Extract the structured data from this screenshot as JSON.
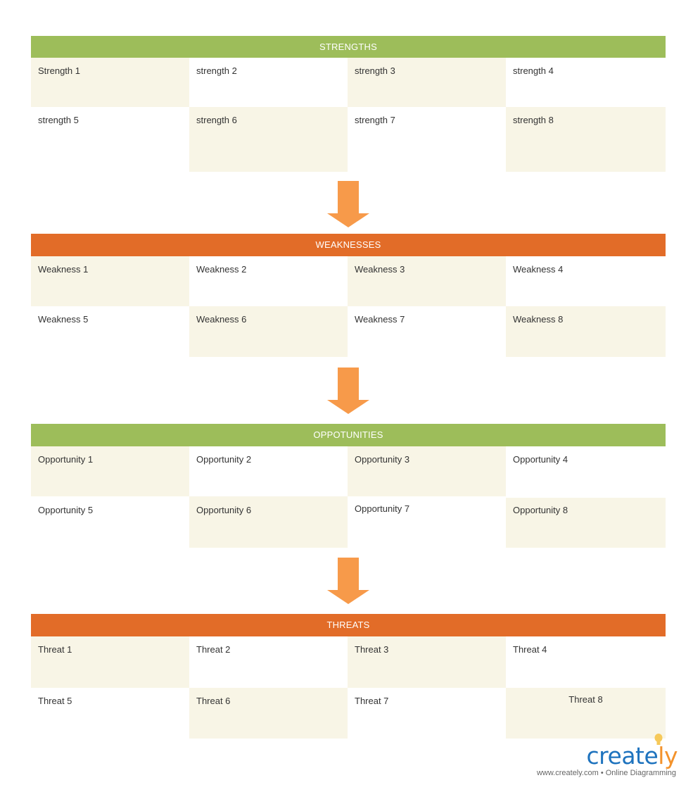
{
  "colors": {
    "green_header": "#9dbd5a",
    "orange_header": "#e26c28",
    "arrow": "#f79a4a",
    "cell_shade": "#f8f5e6"
  },
  "sections": [
    {
      "title": "STRENGTHS",
      "items": [
        "Strength 1",
        "strength 2",
        "strength 3",
        "strength 4",
        "strength 5",
        "strength 6",
        "strength 7",
        "strength 8"
      ]
    },
    {
      "title": "WEAKNESSES",
      "items": [
        "Weakness 1",
        "Weakness 2",
        "Weakness 3",
        "Weakness 4",
        "Weakness 5",
        "Weakness 6",
        "Weakness 7",
        "Weakness 8"
      ]
    },
    {
      "title": "OPPOTUNITIES",
      "items": [
        "Opportunity 1",
        "Opportunity 2",
        "Opportunity 3",
        "Opportunity 4",
        "Opportunity 5",
        "Opportunity 6",
        "Opportunity 7",
        "Opportunity 8"
      ]
    },
    {
      "title": "THREATS",
      "items": [
        "Threat 1",
        "Threat 2",
        "Threat 3",
        "Threat 4",
        "Threat 5",
        "Threat 6",
        "Threat 7",
        "Threat 8"
      ]
    }
  ],
  "arrows": [
    {
      "icon": "down-arrow-icon"
    },
    {
      "icon": "down-arrow-icon"
    },
    {
      "icon": "down-arrow-icon"
    }
  ],
  "branding": {
    "logo_main": "create",
    "logo_accent": "ly",
    "tagline": "www.creately.com • Online Diagramming",
    "bulb_icon": "lightbulb-icon"
  }
}
